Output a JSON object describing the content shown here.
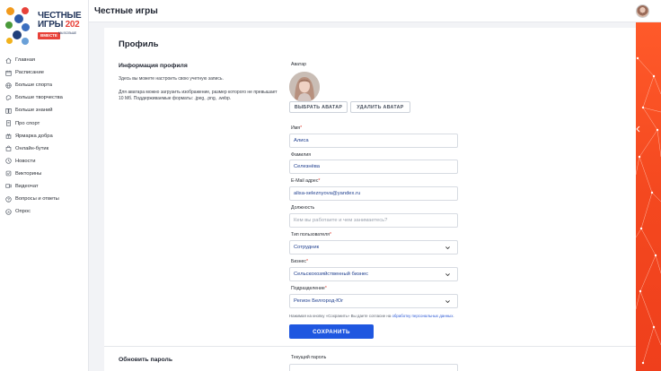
{
  "logo": {
    "line1": "ЧЕСТНЫЕ",
    "line2": "ИГРЫ",
    "year": "20",
    "year2": "2",
    "badge": "ВМЕСТЕ",
    "sub": "МЫ БОЛЬШЕ"
  },
  "header": {
    "title": "Честные игры"
  },
  "sidebar": {
    "items": [
      {
        "label": "Главная",
        "icon": "home-icon"
      },
      {
        "label": "Расписание",
        "icon": "calendar-icon"
      },
      {
        "label": "Больше спорта",
        "icon": "ball-icon"
      },
      {
        "label": "Больше творчества",
        "icon": "palette-icon"
      },
      {
        "label": "Больше знаний",
        "icon": "book-icon"
      },
      {
        "label": "Про спорт",
        "icon": "document-icon"
      },
      {
        "label": "Ярмарка добра",
        "icon": "gift-icon"
      },
      {
        "label": "Онлайн-бутик",
        "icon": "bag-icon"
      },
      {
        "label": "Новости",
        "icon": "news-icon"
      },
      {
        "label": "Викторины",
        "icon": "quiz-icon"
      },
      {
        "label": "Видеочат",
        "icon": "video-icon"
      },
      {
        "label": "Вопросы и ответы",
        "icon": "help-icon"
      },
      {
        "label": "Опрос",
        "icon": "poll-icon"
      }
    ]
  },
  "page": {
    "title": "Профиль",
    "section_title": "Информация профиля",
    "desc1": "Здесь вы можете настроить свою учетную запись.",
    "desc2": "Для аватара можно загрузить изображение, размер которого не превышает 10 Мб. Поддерживаемые форматы: .jpeg, .png, .webp."
  },
  "avatar": {
    "label": "Аватар",
    "choose_label": "ВЫБРАТЬ АВАТАР",
    "delete_label": "УДАЛИТЬ АВАТАР"
  },
  "form": {
    "first_name": {
      "label": "Имя",
      "value": "Алиса"
    },
    "last_name": {
      "label": "Фамилия",
      "value": "Селезнёва"
    },
    "email": {
      "label": "E-Mail адрес",
      "value": "alisa-seleznyova@yandex.ru"
    },
    "position": {
      "label": "Должность",
      "placeholder": "Кем вы работаете и чем занимаетесь?"
    },
    "user_type": {
      "label": "Тип пользователя",
      "value": "Сотрудник"
    },
    "business": {
      "label": "Бизнес",
      "value": "Сельскохозяйственный бизнес"
    },
    "division": {
      "label": "Подразделение",
      "value": "Регион Белгород-Юг"
    },
    "consent_text": "Нажимая на кнопку «Сохранить» Вы даете согласие на ",
    "consent_link": "обработку персональных данных",
    "consent_end": ".",
    "save_label": "СОХРАНИТЬ"
  },
  "password": {
    "title": "Обновить пароль",
    "current_label": "Текущий пароль"
  },
  "colors": {
    "accent": "#1f57e0",
    "required": "#e23b2e",
    "decor": "#f4481f"
  }
}
